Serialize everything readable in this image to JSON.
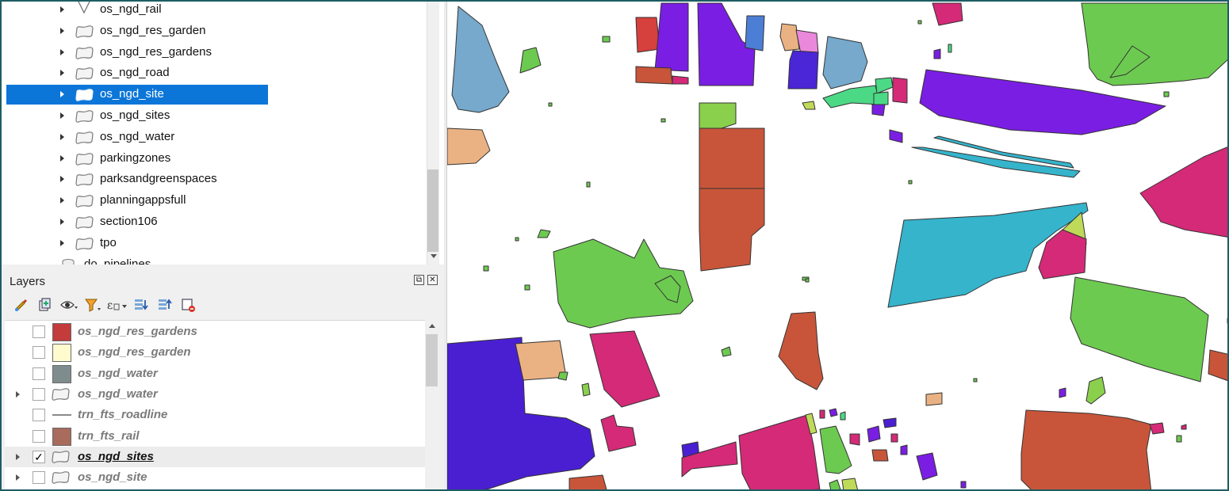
{
  "browser": {
    "items": [
      {
        "label": "os_ngd_rail",
        "selected": false,
        "icon": "line-layer-icon"
      },
      {
        "label": "os_ngd_res_garden",
        "selected": false,
        "icon": "polygon-layer-icon"
      },
      {
        "label": "os_ngd_res_gardens",
        "selected": false,
        "icon": "polygon-layer-icon"
      },
      {
        "label": "os_ngd_road",
        "selected": false,
        "icon": "polygon-layer-icon"
      },
      {
        "label": "os_ngd_site",
        "selected": true,
        "icon": "polygon-layer-icon"
      },
      {
        "label": "os_ngd_sites",
        "selected": false,
        "icon": "polygon-layer-icon"
      },
      {
        "label": "os_ngd_water",
        "selected": false,
        "icon": "polygon-layer-icon"
      },
      {
        "label": "parkingzones",
        "selected": false,
        "icon": "polygon-layer-icon"
      },
      {
        "label": "parksandgreenspaces",
        "selected": false,
        "icon": "polygon-layer-icon"
      },
      {
        "label": "planningappsfull",
        "selected": false,
        "icon": "polygon-layer-icon"
      },
      {
        "label": "section106",
        "selected": false,
        "icon": "polygon-layer-icon"
      },
      {
        "label": "tpo",
        "selected": false,
        "icon": "polygon-layer-icon"
      },
      {
        "label": "do_pipelines",
        "selected": false,
        "icon": "database-icon"
      }
    ]
  },
  "layers_panel": {
    "title": "Layers",
    "float_label": "⧉",
    "close_label": "✕",
    "toolbar_icons": [
      "style-brush-icon",
      "add-group-icon",
      "eye-visibility-icon",
      "filter-icon",
      "expression-filter-icon",
      "expand-all-icon",
      "collapse-all-icon",
      "remove-layer-icon"
    ],
    "rows": [
      {
        "label": "os_ngd_res_gardens",
        "checked": false,
        "expandable": false,
        "symbol": "fill",
        "color": "#c33b3b",
        "active": false
      },
      {
        "label": "os_ngd_res_garden",
        "checked": false,
        "expandable": false,
        "symbol": "fill",
        "color": "#fffbcf",
        "active": false
      },
      {
        "label": "os_ngd_water",
        "checked": false,
        "expandable": false,
        "symbol": "fill",
        "color": "#7f8c8d",
        "active": false
      },
      {
        "label": "os_ngd_water",
        "checked": false,
        "expandable": true,
        "symbol": "polygon-icon",
        "color": "",
        "active": false
      },
      {
        "label": "trn_fts_roadline",
        "checked": false,
        "expandable": false,
        "symbol": "line",
        "color": "#8a8a8a",
        "active": false
      },
      {
        "label": "trn_fts_rail",
        "checked": false,
        "expandable": false,
        "symbol": "fill",
        "color": "#a86b5c",
        "active": false
      },
      {
        "label": "os_ngd_sites",
        "checked": true,
        "expandable": true,
        "symbol": "polygon-icon",
        "color": "",
        "active": true
      },
      {
        "label": "os_ngd_site",
        "checked": false,
        "expandable": true,
        "symbol": "polygon-icon",
        "color": "",
        "active": false
      }
    ]
  },
  "map": {
    "background": "#ffffff",
    "outline_color": "#333333"
  }
}
